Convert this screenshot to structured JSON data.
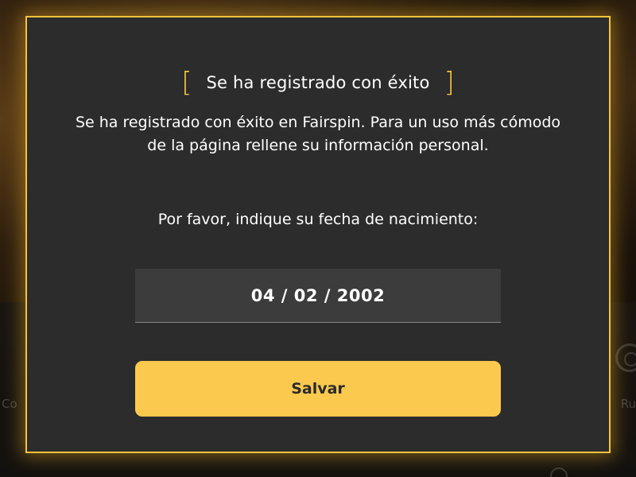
{
  "background": {
    "left_label": "Co",
    "right_label": "Ru"
  },
  "modal": {
    "title": "Se ha registrado con éxito",
    "description": "Se ha registrado con éxito en Fairspin. Para un uso más cómodo de la página rellene su información personal.",
    "prompt": "Por favor, indique su fecha de nacimiento:",
    "birthdate_value": "04 / 02 / 2002",
    "save_label": "Salvar",
    "bracket_left": "[",
    "bracket_right": "]"
  },
  "colors": {
    "accent": "#f5c33b",
    "button": "#fbc94e",
    "modal_bg": "#2c2c2c",
    "input_bg": "#3c3c3c"
  }
}
